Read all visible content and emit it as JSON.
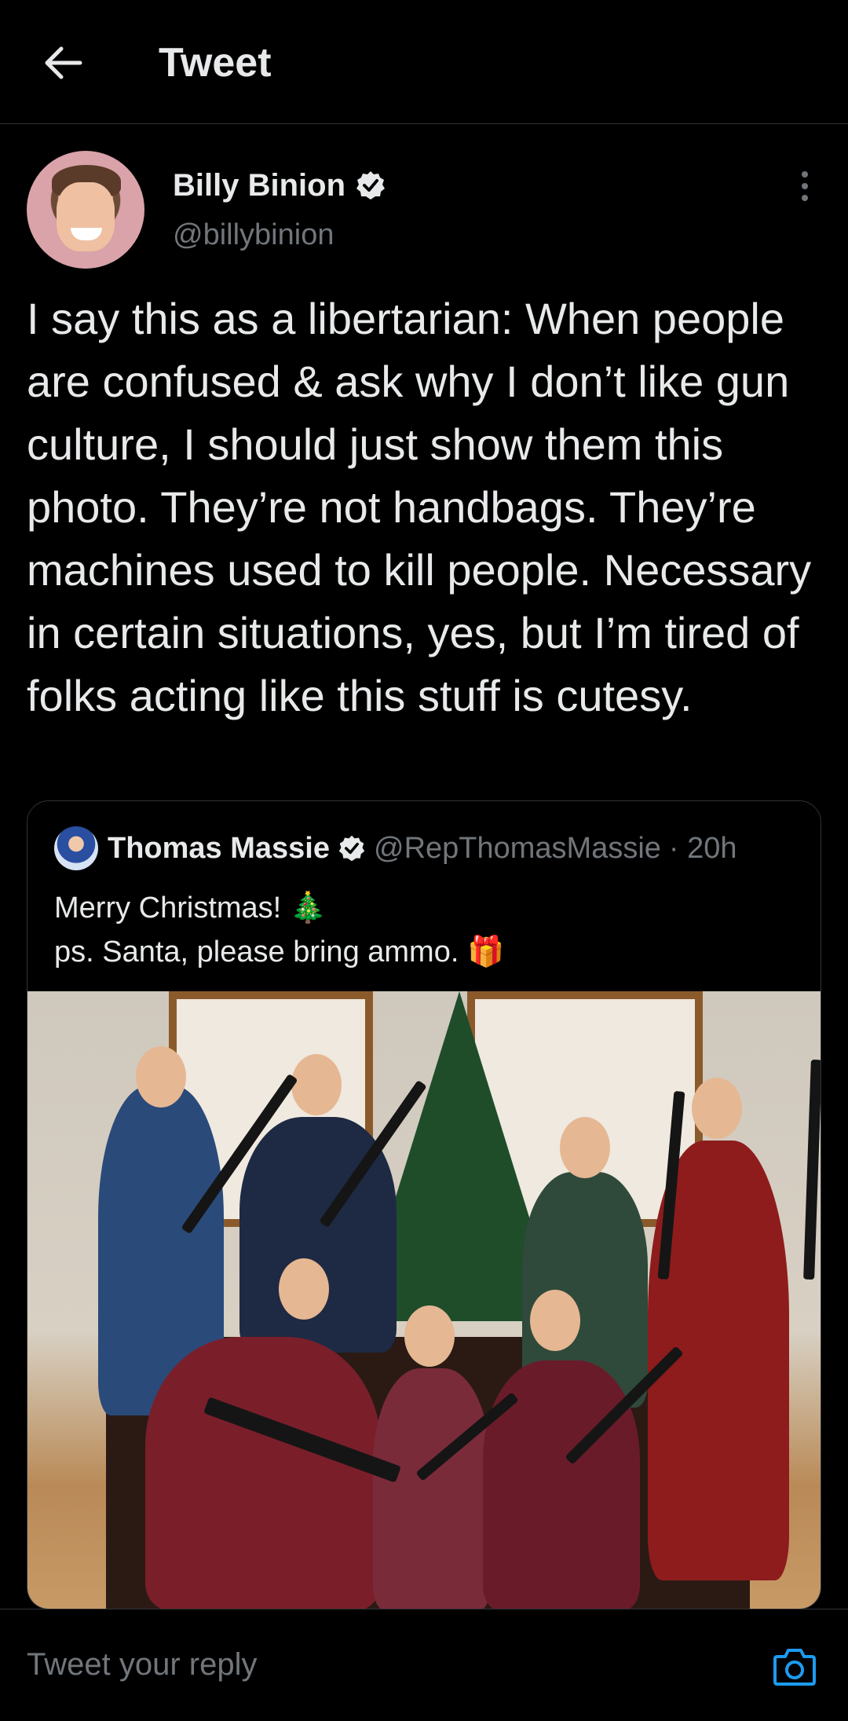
{
  "header": {
    "title": "Tweet",
    "back_icon": "arrow-left-icon"
  },
  "author": {
    "name": "Billy Binion",
    "handle": "@billybinion",
    "verified": true
  },
  "tweet": {
    "text": "I say this as a libertarian: When people are confused & ask why I don’t like gun culture, I should just show them this photo. They’re not handbags. They’re machines used to kill people. Necessary in certain situations, yes, but I’m tired of folks acting like this stuff is cutesy."
  },
  "quoted": {
    "name": "Thomas Massie",
    "handle": "@RepThomasMassie",
    "time": "· 20h",
    "line1": "Merry Christmas! 🎄",
    "line2": "ps. Santa, please bring ammo. 🎁"
  },
  "reply": {
    "placeholder": "Tweet your reply"
  },
  "colors": {
    "background": "#000000",
    "text": "#e7e9ea",
    "muted": "#71767b",
    "accent": "#1d9bf0",
    "border": "#2f3336"
  }
}
